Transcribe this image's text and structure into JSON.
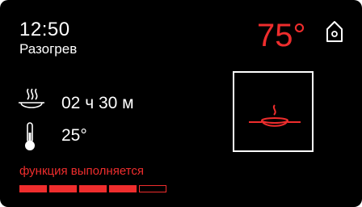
{
  "colors": {
    "background": "#000000",
    "text": "#ffffff",
    "accent": "#ef2d2d"
  },
  "header": {
    "time": "12:50",
    "status": "Разогрев",
    "current_temperature": "75°",
    "home_icon": "home-icon"
  },
  "info": {
    "duration_icon": "dish-steam-icon",
    "duration": "02 ч 30 м",
    "temperature_icon": "thermometer-icon",
    "set_temperature": "25°"
  },
  "function": {
    "label": "функция выполняется",
    "progress_segments_total": 5,
    "progress_segments_filled": 4
  },
  "mode": {
    "icon": "pan-steam-icon"
  }
}
